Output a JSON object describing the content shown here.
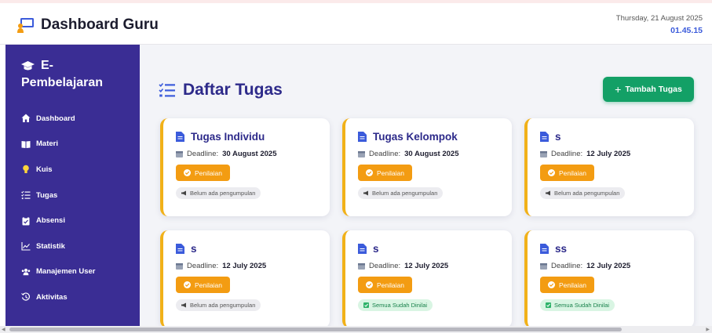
{
  "header": {
    "title": "Dashboard Guru",
    "date": "Thursday, 21 August 2025",
    "time": "01.45.15"
  },
  "sidebar": {
    "logo_line1": "E-",
    "logo_line2": "Pembelajaran",
    "items": [
      {
        "label": "Dashboard",
        "icon": "home-icon"
      },
      {
        "label": "Materi",
        "icon": "book-icon"
      },
      {
        "label": "Kuis",
        "icon": "lightbulb-icon"
      },
      {
        "label": "Tugas",
        "icon": "task-list-icon"
      },
      {
        "label": "Absensi",
        "icon": "clipboard-icon"
      },
      {
        "label": "Statistik",
        "icon": "chart-line-icon"
      },
      {
        "label": "Manajemen User",
        "icon": "users-icon"
      },
      {
        "label": "Aktivitas",
        "icon": "history-icon"
      }
    ]
  },
  "main": {
    "page_title": "Daftar Tugas",
    "add_button": "Tambah Tugas",
    "deadline_label": "Deadline:",
    "assess_label": "Penilaian",
    "cards": [
      {
        "title": "Tugas Individu",
        "deadline": "30 August 2025",
        "status": "Belum ada pengumpulan",
        "status_type": "pending"
      },
      {
        "title": "Tugas Kelompok",
        "deadline": "30 August 2025",
        "status": "Belum ada pengumpulan",
        "status_type": "pending"
      },
      {
        "title": "s",
        "deadline": "12 July 2025",
        "status": "Belum ada pengumpulan",
        "status_type": "pending"
      },
      {
        "title": "s",
        "deadline": "12 July 2025",
        "status": "Belum ada pengumpulan",
        "status_type": "pending"
      },
      {
        "title": "s",
        "deadline": "12 July 2025",
        "status": "Semua Sudah Dinilai",
        "status_type": "done"
      },
      {
        "title": "ss",
        "deadline": "12 July 2025",
        "status": "Semua Sudah Dinilai",
        "status_type": "done"
      }
    ]
  },
  "colors": {
    "sidebar_bg": "#3a2d94",
    "title_color": "#2d2a8a",
    "add_button": "#13a066",
    "assess_button": "#f39c12",
    "card_accent": "#f1b119"
  }
}
